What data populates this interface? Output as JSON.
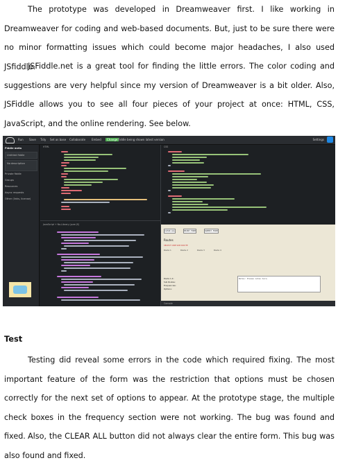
{
  "paragraphs": [
    {
      "text": "The prototype was developed in Dreamweaver first. I like working in Dreamweaver for coding and web-based documents. But, just to be sure there were no minor formatting issues which could become major headaches, I also used JSfiddle."
    },
    {
      "text": "JSFiddle.net is a great tool for finding the little errors. The color coding and suggestions are very helpful since my version of Dreamweaver is a bit older. Also, JSFiddle allows you to see all four pieces of your project at once: HTML, CSS, JavaScript, and the online rendering. See below."
    },
    {
      "text": "Testing did reveal some errors in the code which required fixing. The most important feature of the form was the restriction that options must be chosen correctly for the next set of options to appear. At the prototype stage, the multiple check boxes in the frequency section were not working. The bug was found and fixed."
    },
    {
      "text": "Also, the CLEAR ALL button did not always clear the entire form. This bug was also found and fixed."
    }
  ],
  "heading": "Test",
  "screenshot": {
    "toolbar": [
      "Run",
      "Save",
      "Tidy",
      "Set as base",
      "Collaborate",
      "Embed"
    ],
    "update_badge": "Change",
    "toolbar_note": "Fiddle being shown latest version",
    "settings_label": "Settings",
    "sidebar": {
      "header": "Fiddle meta",
      "title_placeholder": "Untitled fiddle",
      "description_placeholder": "No description",
      "items": [
        "Private fiddle",
        "Groups",
        "Resources",
        "Async requests",
        "Other (links, license)"
      ]
    },
    "pane_labels": [
      "HTML",
      "CSS",
      "JavaScript + No-Library (pure JS)"
    ],
    "preview": {
      "buttons": [
        "CLEAR ALL",
        "PRINT FORM",
        "SUBMIT FORM"
      ],
      "title": "Routes",
      "subtitle": "SELECT ONE SUB ROUTE",
      "checkboxes": [
        "Route 1",
        "Route 2",
        "Route 3",
        "Route 4"
      ],
      "info_lines": [
        "Route 1-4:",
        "Sub Routes:",
        "Frequencies:",
        "Options:"
      ],
      "textarea_placeholder": "Notes: Please notes here."
    },
    "console_label": "Console"
  },
  "colors": {
    "editor_bg": "#1d2023",
    "tag": "#e06c75",
    "attr": "#98c379",
    "keyword": "#c678dd",
    "string": "#e5c07b",
    "plain": "#abb2bf",
    "update_green": "#4caf50",
    "accent_blue": "#1e88e5"
  }
}
